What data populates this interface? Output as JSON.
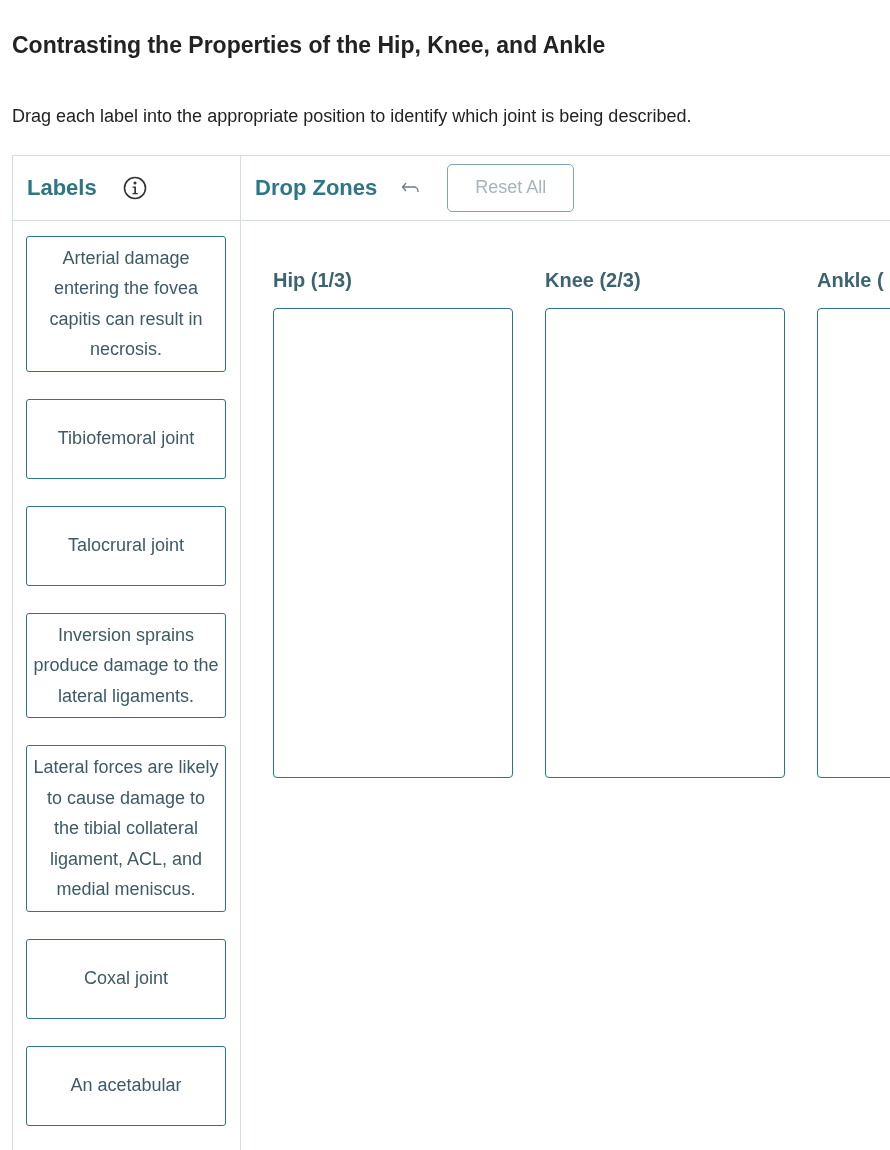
{
  "title": "Contrasting the Properties of the Hip, Knee, and Ankle",
  "instructions": "Drag each label into the appropriate position to identify which joint is being described.",
  "labels_panel": {
    "heading": "Labels",
    "items": [
      {
        "text": "Arterial damage entering the fovea capitis can result in necrosis."
      },
      {
        "text": "Tibiofemoral joint"
      },
      {
        "text": "Talocrural joint"
      },
      {
        "text": "Inversion sprains produce damage to the lateral ligaments."
      },
      {
        "text": "Lateral forces are likely to cause damage to the tibial collateral ligament, ACL, and medial meniscus."
      },
      {
        "text": "Coxal joint"
      },
      {
        "text": "An acetabular"
      }
    ]
  },
  "drop_panel": {
    "heading": "Drop Zones",
    "reset_button": {
      "label": "Reset All",
      "disabled": true
    },
    "zones": [
      {
        "heading": "Hip (1/3)"
      },
      {
        "heading": "Knee (2/3)"
      },
      {
        "heading": "Ankle ("
      }
    ]
  }
}
